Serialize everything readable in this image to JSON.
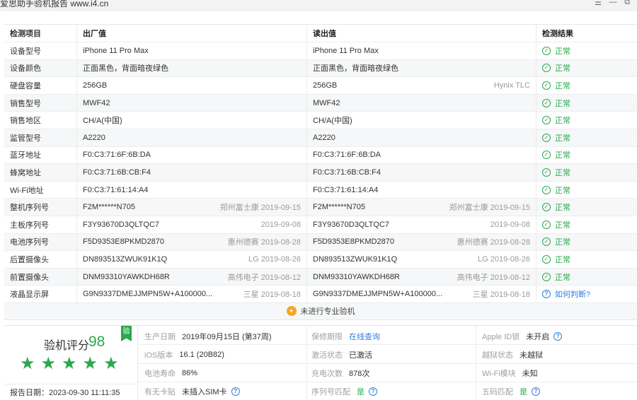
{
  "window": {
    "title": "爱思助手验机报告 www.i4.cn",
    "controls": [
      "☰",
      "—",
      "⧉"
    ]
  },
  "table": {
    "headers": [
      "检测项目",
      "出厂值",
      "读出值",
      "检测结果"
    ],
    "rows": [
      {
        "item": "设备型号",
        "factory": "iPhone 11 Pro Max",
        "factory_note": "",
        "read": "iPhone 11 Pro Max",
        "read_note": "",
        "result": "正常",
        "status": "ok"
      },
      {
        "item": "设备颜色",
        "factory": "正面黑色，背面暗夜绿色",
        "factory_note": "",
        "read": "正面黑色，背面暗夜绿色",
        "read_note": "",
        "result": "正常",
        "status": "ok"
      },
      {
        "item": "硬盘容量",
        "factory": "256GB",
        "factory_note": "",
        "read": "256GB",
        "read_note": "Hynix TLC",
        "result": "正常",
        "status": "ok"
      },
      {
        "item": "销售型号",
        "factory": "MWF42",
        "factory_note": "",
        "read": "MWF42",
        "read_note": "",
        "result": "正常",
        "status": "ok"
      },
      {
        "item": "销售地区",
        "factory": "CH/A(中国)",
        "factory_note": "",
        "read": "CH/A(中国)",
        "read_note": "",
        "result": "正常",
        "status": "ok"
      },
      {
        "item": "监管型号",
        "factory": "A2220",
        "factory_note": "",
        "read": "A2220",
        "read_note": "",
        "result": "正常",
        "status": "ok"
      },
      {
        "item": "蓝牙地址",
        "factory": "F0:C3:71:6F:6B:DA",
        "factory_note": "",
        "read": "F0:C3:71:6F:6B:DA",
        "read_note": "",
        "result": "正常",
        "status": "ok"
      },
      {
        "item": "蜂窝地址",
        "factory": "F0:C3:71:6B:CB:F4",
        "factory_note": "",
        "read": "F0:C3:71:6B:CB:F4",
        "read_note": "",
        "result": "正常",
        "status": "ok"
      },
      {
        "item": "Wi-Fi地址",
        "factory": "F0:C3:71:61:14:A4",
        "factory_note": "",
        "read": "F0:C3:71:61:14:A4",
        "read_note": "",
        "result": "正常",
        "status": "ok"
      },
      {
        "item": "整机序列号",
        "factory": "F2M******N705",
        "factory_note": "郑州富士康 2019-09-15",
        "read": "F2M******N705",
        "read_note": "郑州富士康 2019-09-15",
        "result": "正常",
        "status": "ok"
      },
      {
        "item": "主板序列号",
        "factory": "F3Y93670D3QLTQC7",
        "factory_note": "2019-09-08",
        "read": "F3Y93670D3QLTQC7",
        "read_note": "2019-09-08",
        "result": "正常",
        "status": "ok"
      },
      {
        "item": "电池序列号",
        "factory": "F5D9353E8PKMD2870",
        "factory_note": "惠州德赛 2019-08-28",
        "read": "F5D9353E8PKMD2870",
        "read_note": "惠州德赛 2019-08-28",
        "result": "正常",
        "status": "ok"
      },
      {
        "item": "后置摄像头",
        "factory": "DN893513ZWUK91K1Q",
        "factory_note": "LG 2019-08-26",
        "read": "DN893513ZWUK91K1Q",
        "read_note": "LG 2019-08-26",
        "result": "正常",
        "status": "ok"
      },
      {
        "item": "前置摄像头",
        "factory": "DNM93310YAWKDH68R",
        "factory_note": "高伟电子 2019-08-12",
        "read": "DNM93310YAWKDH68R",
        "read_note": "高伟电子 2019-08-12",
        "result": "正常",
        "status": "ok"
      },
      {
        "item": "液晶显示屏",
        "factory": "G9N9337DMEJJMPN5W+A100000...",
        "factory_note": "三星 2019-08-18",
        "read": "G9N9337DMEJJMPN5W+A100000...",
        "read_note": "三星 2019-08-18",
        "result": "如何判断?",
        "status": "help"
      }
    ],
    "pro_check": "未进行专业验机"
  },
  "summary": {
    "score_label": "验机评分",
    "score": "98",
    "badge": "验",
    "stars": 5,
    "report_date": "报告日期：2023-09-30 11:11:35",
    "info": [
      {
        "key": "生产日期",
        "value": "2019年09月15日 (第37周)"
      },
      {
        "key": "保修期限",
        "value": "在线查询"
      },
      {
        "key": "Apple ID锁",
        "value": "未开启"
      },
      {
        "key": "iOS版本",
        "value": "16.1 (20B82)"
      },
      {
        "key": "激活状态",
        "value": "已激活"
      },
      {
        "key": "越狱状态",
        "value": "未越狱"
      },
      {
        "key": "电池寿命",
        "value": "86%"
      },
      {
        "key": "充电次数",
        "value": "878次"
      },
      {
        "key": "Wi-Fi模块",
        "value": "未知"
      },
      {
        "key": "有无卡贴",
        "value": "未插入SIM卡"
      },
      {
        "key": "序列号匹配",
        "value": "是"
      },
      {
        "key": "五码匹配",
        "value": "是"
      }
    ]
  },
  "colors": {
    "ok": "#2aa84a",
    "link": "#2f7fe0",
    "muted": "#a0a0a0"
  },
  "icons": {
    "ok": "check-circle-icon",
    "help": "question-circle-icon",
    "pro": "lightbulb-icon",
    "star": "star-icon"
  }
}
